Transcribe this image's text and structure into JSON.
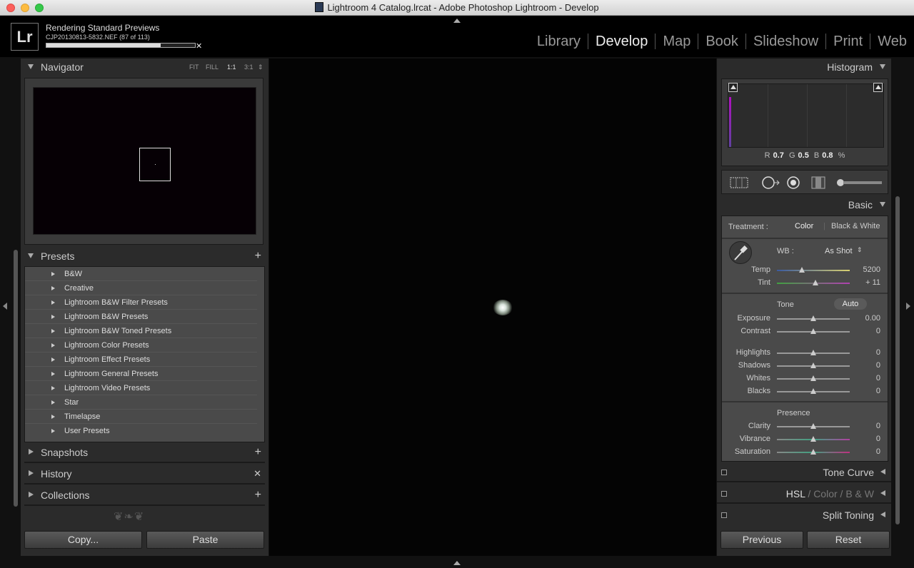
{
  "window": {
    "title": "Lightroom 4 Catalog.lrcat - Adobe Photoshop Lightroom - Develop"
  },
  "topbar": {
    "logo": "Lr",
    "status_title": "Rendering Standard Previews",
    "status_detail": "CJP20130813-5832.NEF (87 of 113)",
    "progress": 0.77,
    "modules": [
      "Library",
      "Develop",
      "Map",
      "Book",
      "Slideshow",
      "Print",
      "Web"
    ],
    "active_module": "Develop"
  },
  "navigator": {
    "title": "Navigator",
    "zoom": [
      "FIT",
      "FILL",
      "1:1",
      "3:1"
    ]
  },
  "presets": {
    "title": "Presets",
    "items": [
      "B&W",
      "Creative",
      "Lightroom B&W Filter Presets",
      "Lightroom B&W Presets",
      "Lightroom B&W Toned Presets",
      "Lightroom Color Presets",
      "Lightroom Effect Presets",
      "Lightroom General Presets",
      "Lightroom Video Presets",
      "Star",
      "Timelapse",
      "User Presets"
    ]
  },
  "snapshots": {
    "title": "Snapshots"
  },
  "history": {
    "title": "History"
  },
  "collections": {
    "title": "Collections"
  },
  "leftbuttons": {
    "copy": "Copy...",
    "paste": "Paste"
  },
  "histogram": {
    "title": "Histogram",
    "r_label": "R",
    "r": "0.7",
    "g_label": "G",
    "g": "0.5",
    "b_label": "B",
    "b": "0.8",
    "pct": "%"
  },
  "basic": {
    "title": "Basic",
    "treatment_label": "Treatment :",
    "treatment_color": "Color",
    "treatment_bw": "Black & White",
    "wb_label": "WB :",
    "wb_value": "As Shot",
    "temp_label": "Temp",
    "temp": "5200",
    "tint_label": "Tint",
    "tint": "+ 11",
    "tone_label": "Tone",
    "auto": "Auto",
    "exposure_label": "Exposure",
    "exposure": "0.00",
    "contrast_label": "Contrast",
    "contrast": "0",
    "highlights_label": "Highlights",
    "highlights": "0",
    "shadows_label": "Shadows",
    "shadows": "0",
    "whites_label": "Whites",
    "whites": "0",
    "blacks_label": "Blacks",
    "blacks": "0",
    "presence_label": "Presence",
    "clarity_label": "Clarity",
    "clarity": "0",
    "vibrance_label": "Vibrance",
    "vibrance": "0",
    "saturation_label": "Saturation",
    "saturation": "0"
  },
  "tonecurve": {
    "title": "Tone Curve"
  },
  "hsl": {
    "hsl": "HSL",
    "slash1": "/",
    "color": "Color",
    "slash2": "/",
    "bw": "B & W"
  },
  "splittoning": {
    "title": "Split Toning"
  },
  "rightbuttons": {
    "previous": "Previous",
    "reset": "Reset"
  }
}
